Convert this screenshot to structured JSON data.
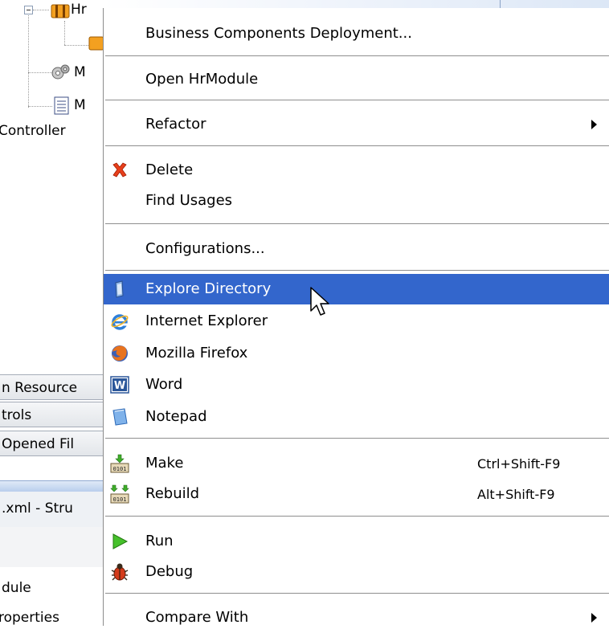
{
  "background": {
    "tree_items": [
      "Hr",
      "M",
      "M"
    ],
    "controller_label": "Controller",
    "panels": [
      "n Resource",
      "trols",
      "Opened Fil"
    ],
    "structure_tab": ".xml - Stru",
    "bottom_items": [
      "dule",
      "roperties"
    ]
  },
  "menu": {
    "business_components_deployment": "Business Components Deployment...",
    "open_hrmodule": "Open HrModule",
    "refactor": "Refactor",
    "delete": "Delete",
    "find_usages": "Find Usages",
    "configurations": "Configurations...",
    "explore_directory": "Explore Directory",
    "internet_explorer": "Internet Explorer",
    "mozilla_firefox": "Mozilla Firefox",
    "word": "Word",
    "notepad": "Notepad",
    "make": "Make",
    "make_shortcut": "Ctrl+Shift-F9",
    "rebuild": "Rebuild",
    "rebuild_shortcut": "Alt+Shift-F9",
    "run": "Run",
    "debug": "Debug",
    "compare_with": "Compare With"
  },
  "colors": {
    "highlight": "#3366cc",
    "separator": "#8e8e8e"
  }
}
